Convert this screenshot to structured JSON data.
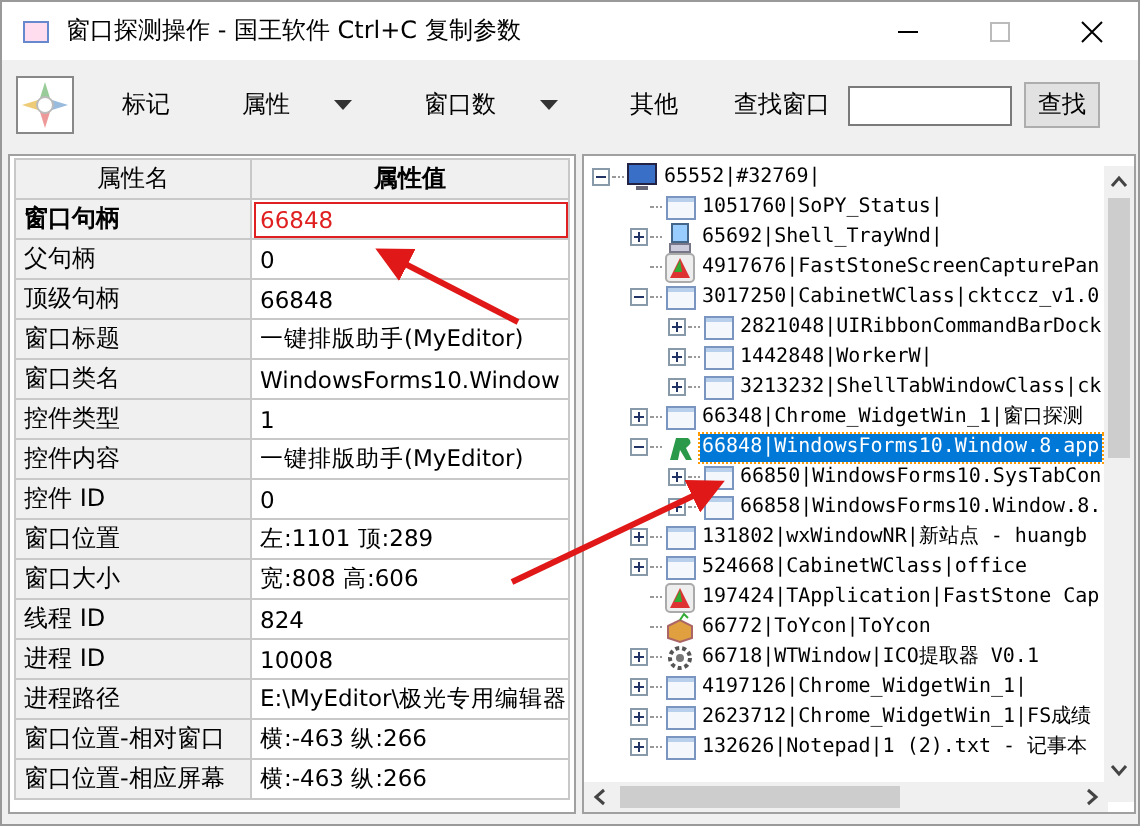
{
  "window": {
    "title": "窗口探测操作 - 国王软件 Ctrl+C 复制参数"
  },
  "toolbar": {
    "items": [
      {
        "label": "标记",
        "dropdown": false
      },
      {
        "label": "属性",
        "dropdown": true
      },
      {
        "label": "窗口数",
        "dropdown": true
      },
      {
        "label": "其他",
        "dropdown": false
      }
    ],
    "search_label": "查找窗口",
    "search_button": "查找"
  },
  "properties": {
    "columns": [
      "属性名",
      "属性值"
    ],
    "rows": [
      {
        "name": "窗口句柄",
        "value": "66848",
        "selected": true
      },
      {
        "name": "父句柄",
        "value": "0",
        "selected": false
      },
      {
        "name": "顶级句柄",
        "value": "66848",
        "selected": false
      },
      {
        "name": "窗口标题",
        "value": "一键排版助手(MyEditor)",
        "selected": false
      },
      {
        "name": "窗口类名",
        "value": "WindowsForms10.Window",
        "selected": false
      },
      {
        "name": "控件类型",
        "value": "1",
        "selected": false
      },
      {
        "name": "控件内容",
        "value": "一键排版助手(MyEditor)",
        "selected": false
      },
      {
        "name": "控件 ID",
        "value": "0",
        "selected": false
      },
      {
        "name": "窗口位置",
        "value": "左:1101 顶:289",
        "selected": false
      },
      {
        "name": "窗口大小",
        "value": "宽:808 高:606",
        "selected": false
      },
      {
        "name": "线程 ID",
        "value": "824",
        "selected": false
      },
      {
        "name": "进程 ID",
        "value": "10008",
        "selected": false
      },
      {
        "name": "进程路径",
        "value": "E:\\MyEditor\\极光专用编辑器",
        "selected": false
      },
      {
        "name": "窗口位置-相对窗口",
        "value": "横:-463 纵:266",
        "selected": false
      },
      {
        "name": "窗口位置-相应屏幕",
        "value": "横:-463 纵:266",
        "selected": false
      }
    ]
  },
  "tree": [
    {
      "label": "65552|#32769|",
      "kind": "monitor",
      "expandable": true,
      "expanded": true,
      "selected": false,
      "children": [
        {
          "label": "1051760|SoPY_Status|",
          "kind": "window",
          "expandable": false,
          "selected": false
        },
        {
          "label": "65692|Shell_TrayWnd|",
          "kind": "computer",
          "expandable": true,
          "expanded": false,
          "selected": false
        },
        {
          "label": "4917676|FastStoneScreenCapturePan",
          "kind": "capture",
          "expandable": false,
          "selected": false
        },
        {
          "label": "3017250|CabinetWClass|cktccz_v1.0",
          "kind": "window",
          "expandable": true,
          "expanded": true,
          "selected": false,
          "children": [
            {
              "label": "2821048|UIRibbonCommandBarDock",
              "kind": "window",
              "expandable": true,
              "expanded": false,
              "selected": false
            },
            {
              "label": "1442848|WorkerW|",
              "kind": "window",
              "expandable": true,
              "expanded": false,
              "selected": false
            },
            {
              "label": "3213232|ShellTabWindowClass|ck",
              "kind": "window",
              "expandable": true,
              "expanded": false,
              "selected": false
            }
          ]
        },
        {
          "label": "66348|Chrome_WidgetWin_1|窗口探测",
          "kind": "window",
          "expandable": true,
          "expanded": false,
          "selected": false
        },
        {
          "label": "66848|WindowsForms10.Window.8.app",
          "kind": "logo",
          "expandable": true,
          "expanded": true,
          "selected": true,
          "children": [
            {
              "label": "66850|WindowsForms10.SysTabCon",
              "kind": "window",
              "expandable": true,
              "expanded": false,
              "selected": false
            },
            {
              "label": "66858|WindowsForms10.Window.8.",
              "kind": "window",
              "expandable": true,
              "expanded": false,
              "selected": false
            }
          ]
        },
        {
          "label": "131802|wxWindowNR|新站点 - huangb",
          "kind": "window",
          "expandable": true,
          "expanded": false,
          "selected": false
        },
        {
          "label": "524668|CabinetWClass|office",
          "kind": "window",
          "expandable": true,
          "expanded": false,
          "selected": false
        },
        {
          "label": "197424|TApplication|FastStone Cap",
          "kind": "capture",
          "expandable": false,
          "selected": false
        },
        {
          "label": "66772|ToYcon|ToYcon",
          "kind": "package",
          "expandable": false,
          "selected": false
        },
        {
          "label": "66718|WTWindow|ICO提取器 V0.1",
          "kind": "gear",
          "expandable": true,
          "expanded": false,
          "selected": false
        },
        {
          "label": "4197126|Chrome_WidgetWin_1|",
          "kind": "window",
          "expandable": true,
          "expanded": false,
          "selected": false
        },
        {
          "label": "2623712|Chrome_WidgetWin_1|FS成绩",
          "kind": "window",
          "expandable": true,
          "expanded": false,
          "selected": false
        },
        {
          "label": "132626|Notepad|1 (2).txt - 记事本",
          "kind": "window",
          "expandable": true,
          "expanded": false,
          "selected": false
        }
      ]
    }
  ]
}
